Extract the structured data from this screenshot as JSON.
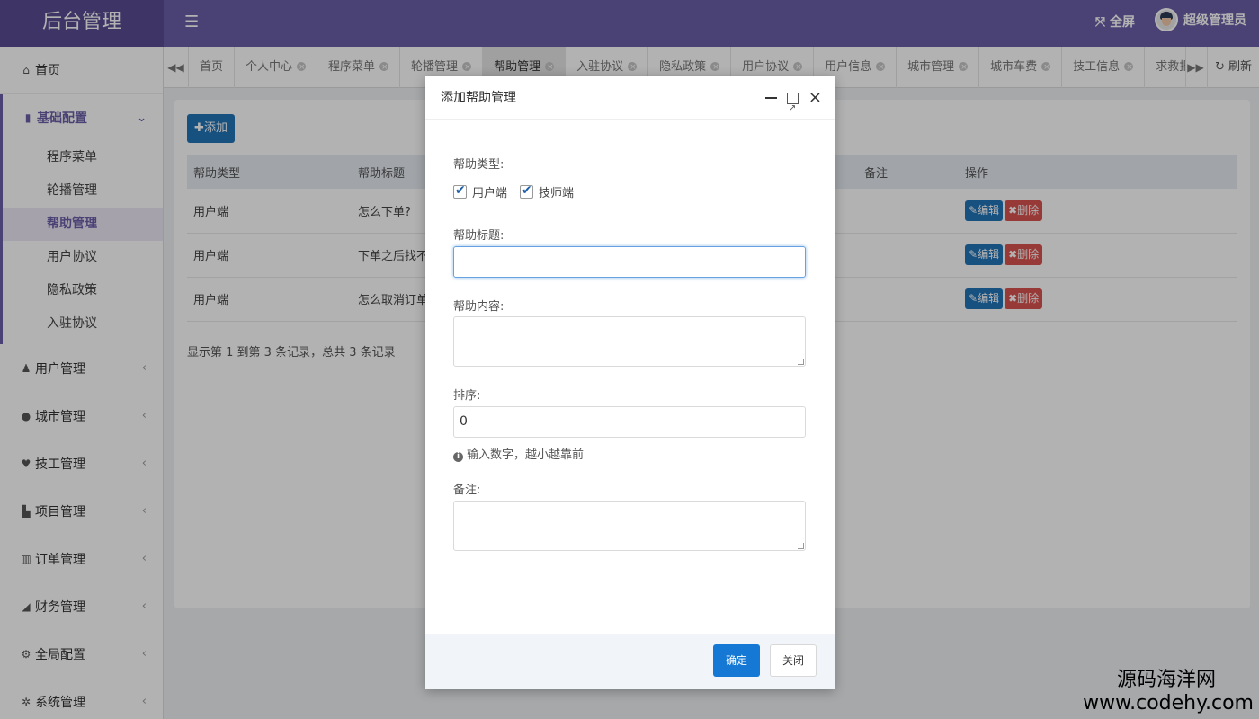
{
  "header": {
    "brand": "后台管理",
    "menu_icon": "☰",
    "fullscreen": "全屏",
    "user_name": "超级管理员"
  },
  "sidebar": {
    "home": "首页",
    "group_label": "基础配置",
    "group_items": [
      "程序菜单",
      "轮播管理",
      "帮助管理",
      "用户协议",
      "隐私政策",
      "入驻协议"
    ],
    "active_item": "帮助管理",
    "items": [
      "用户管理",
      "城市管理",
      "技工管理",
      "项目管理",
      "订单管理",
      "财务管理",
      "全局配置",
      "系统管理"
    ],
    "item_icons": [
      "user-icon",
      "globe-icon",
      "heart-icon",
      "book-icon",
      "bar-chart-icon",
      "area-chart-icon",
      "cogs-icon",
      "gear-icon"
    ]
  },
  "tabs": {
    "items": [
      "首页",
      "个人中心",
      "程序菜单",
      "轮播管理",
      "帮助管理",
      "入驻协议",
      "隐私政策",
      "用户协议",
      "用户信息",
      "城市管理",
      "城市车费",
      "技工信息",
      "求救报警"
    ],
    "active": "帮助管理",
    "refresh": "刷新"
  },
  "content": {
    "add_button": "添加",
    "columns": [
      "帮助类型",
      "帮助标题",
      "备注",
      "操作"
    ],
    "rows": [
      {
        "type": "用户端",
        "title": "怎么下单?",
        "remark": ""
      },
      {
        "type": "用户端",
        "title": "下单之后找不到",
        "remark": ""
      },
      {
        "type": "用户端",
        "title": "怎么取消订单?",
        "remark": ""
      }
    ],
    "edit_label": "编辑",
    "delete_label": "删除",
    "pager_info": "显示第 1 到第 3 条记录，总共 3 条记录"
  },
  "modal": {
    "title": "添加帮助管理",
    "type_label": "帮助类型:",
    "checkbox_user": "用户端",
    "checkbox_tech": "技师端",
    "title_label": "帮助标题:",
    "title_value": "",
    "content_label": "帮助内容:",
    "sort_label": "排序:",
    "sort_value": "0",
    "sort_hint": "输入数字，越小越靠前",
    "remark_label": "备注:",
    "ok_button": "确定",
    "close_button": "关闭"
  },
  "watermark": {
    "line1": "源码海洋网",
    "line2": "www.codehy.com"
  }
}
